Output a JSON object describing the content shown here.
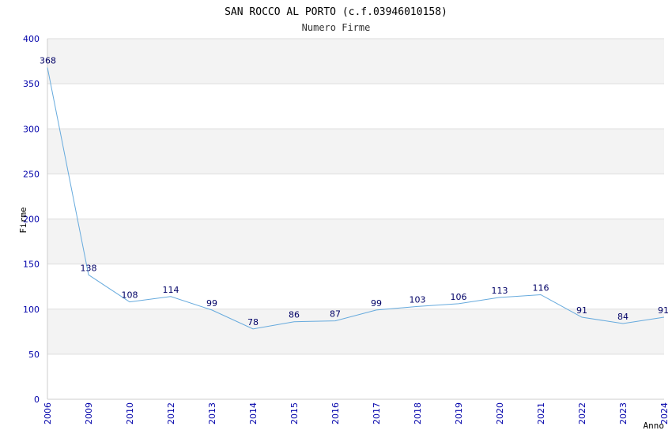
{
  "chart_data": {
    "type": "line",
    "title": "SAN ROCCO AL PORTO (c.f.03946010158)",
    "subtitle": "Numero Firme",
    "xlabel": "Anno",
    "ylabel": "Firme",
    "categories": [
      "2006",
      "2009",
      "2010",
      "2012",
      "2013",
      "2014",
      "2015",
      "2016",
      "2017",
      "2018",
      "2019",
      "2020",
      "2021",
      "2022",
      "2023",
      "2024"
    ],
    "series": [
      {
        "values": [
          368,
          138,
          108,
          114,
          99,
          78,
          86,
          87,
          99,
          103,
          106,
          113,
          116,
          91,
          84,
          91
        ]
      }
    ],
    "ylim": [
      0,
      400
    ],
    "yticks": [
      0,
      50,
      100,
      150,
      200,
      250,
      300,
      350,
      400
    ],
    "grid": true,
    "line_color": "#66aadd",
    "band_color": "#f3f3f3",
    "tick_color": "#0000aa",
    "label_color": "#000066"
  }
}
